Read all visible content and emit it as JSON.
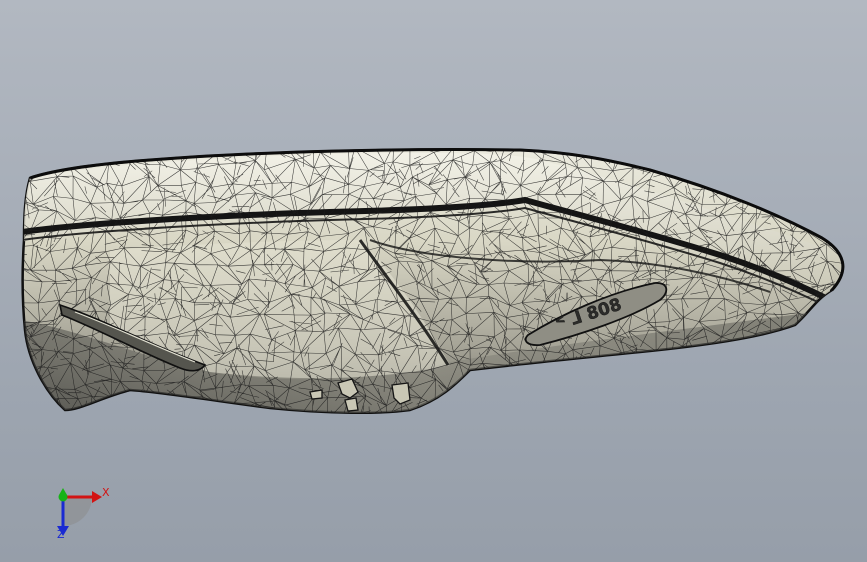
{
  "viewport": {
    "background_top": "#b2b8c1",
    "background_bottom": "#969ea9"
  },
  "model": {
    "fill_color": "#d8d6c4",
    "shade_color": "#8b8a80",
    "mesh_color": "#1c1c1c",
    "engraving_text": "ᑉ ⅃ 808"
  },
  "triad": {
    "x_label": "X",
    "z_label": "Z",
    "x_color": "#d21414",
    "y_color": "#17b317",
    "z_color": "#1a2ad2"
  }
}
